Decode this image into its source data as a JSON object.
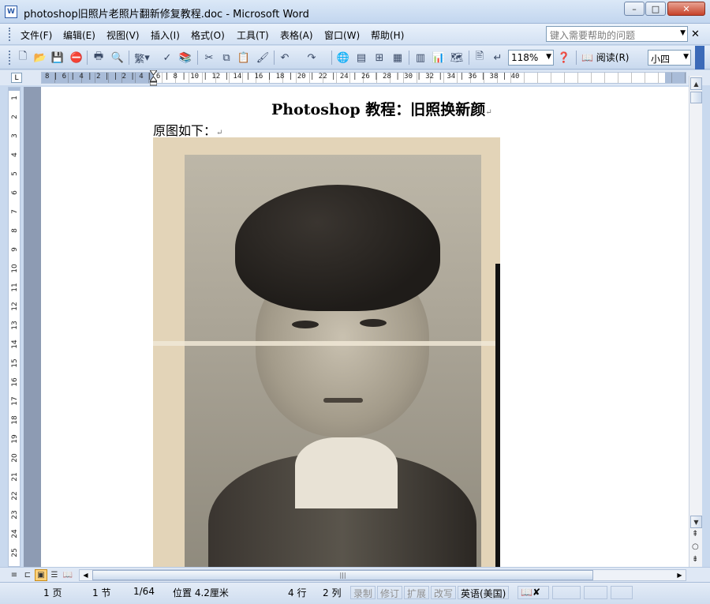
{
  "window": {
    "title": "photoshop旧照片老照片翻新修复教程.doc - Microsoft Word",
    "app_icon": "W",
    "minimize": "–",
    "maximize": "□",
    "close": "✕"
  },
  "menubar": {
    "items": [
      "文件(F)",
      "编辑(E)",
      "视图(V)",
      "插入(I)",
      "格式(O)",
      "工具(T)",
      "表格(A)",
      "窗口(W)",
      "帮助(H)"
    ],
    "help_placeholder": "键入需要帮助的问题",
    "doc_close": "✕"
  },
  "toolbar": {
    "traditional": "繁",
    "zoom": "118%",
    "read_label": "阅读(R)",
    "style": "小四"
  },
  "ruler": {
    "tab_selector": "L",
    "h_numbers": "8  |  6  |  4  |  2  |     |  2  |  4  |  6  |  8  | 10  | 12  | 14  | 16  | 18  | 20  | 22  | 24  | 26  | 28  | 30  | 32  | 34  | 36  | 38  | 40",
    "v_numbers": [
      "1",
      "2",
      "3",
      "4",
      "5",
      "6",
      "7",
      "8",
      "9",
      "10",
      "11",
      "12",
      "13",
      "14",
      "15",
      "16",
      "17",
      "18",
      "19",
      "20",
      "21",
      "22",
      "23",
      "24",
      "25"
    ]
  },
  "document": {
    "title": "Photoshop 教程：旧照换新颜",
    "line1": "原图如下：",
    "paragraph_mark": "↵"
  },
  "statusbar": {
    "page": "1 页",
    "section": "1 节",
    "page_of": "1/64",
    "position": "位置 4.2厘米",
    "line": "4 行",
    "column": "2 列",
    "rec": "录制",
    "trk": "修订",
    "ext": "扩展",
    "ovr": "改写",
    "language": "英语(美国)"
  }
}
